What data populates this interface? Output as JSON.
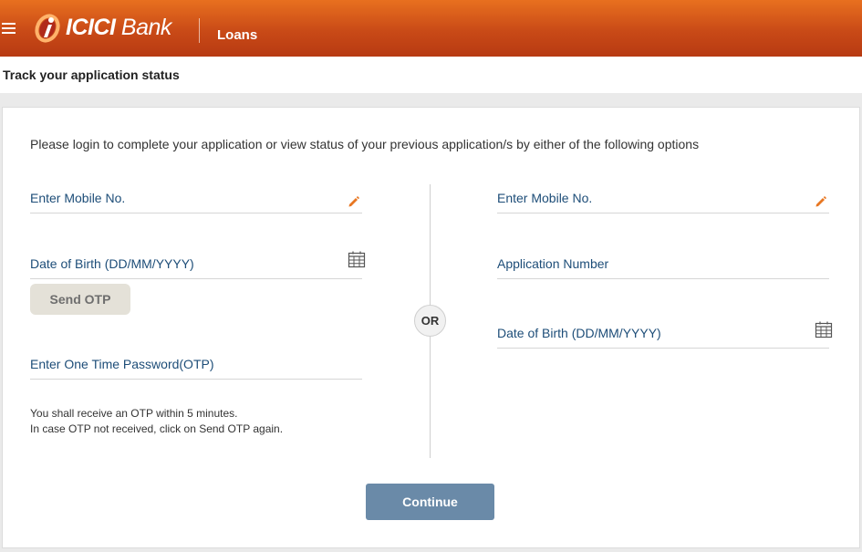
{
  "header": {
    "brand": "ICICI",
    "brand_suffix": "Bank",
    "section": "Loans",
    "colors": {
      "header_start": "#e8701f",
      "header_end": "#b73a12",
      "logo_red": "#b02a1a"
    }
  },
  "page_title": "Track your application status",
  "intro_text": "Please login to complete your application or view status of your previous application/s by either of the following options",
  "left_form": {
    "mobile_label": "Enter Mobile No.",
    "dob_label": "Date of Birth (DD/MM/YYYY)",
    "send_otp_label": "Send OTP",
    "otp_label": "Enter One Time Password(OTP)",
    "note_line1": "You shall receive an OTP within 5 minutes.",
    "note_line2": "In case OTP not received, click on Send OTP again."
  },
  "divider_label": "OR",
  "right_form": {
    "mobile_label": "Enter Mobile No.",
    "application_label": "Application Number",
    "dob_label": "Date of Birth (DD/MM/YYYY)"
  },
  "continue_label": "Continue",
  "icons": {
    "menu": "hamburger-menu-icon",
    "edit": "pencil-icon",
    "calendar": "calendar-icon",
    "accent": "#e87722",
    "label_color": "#1d4d78"
  }
}
